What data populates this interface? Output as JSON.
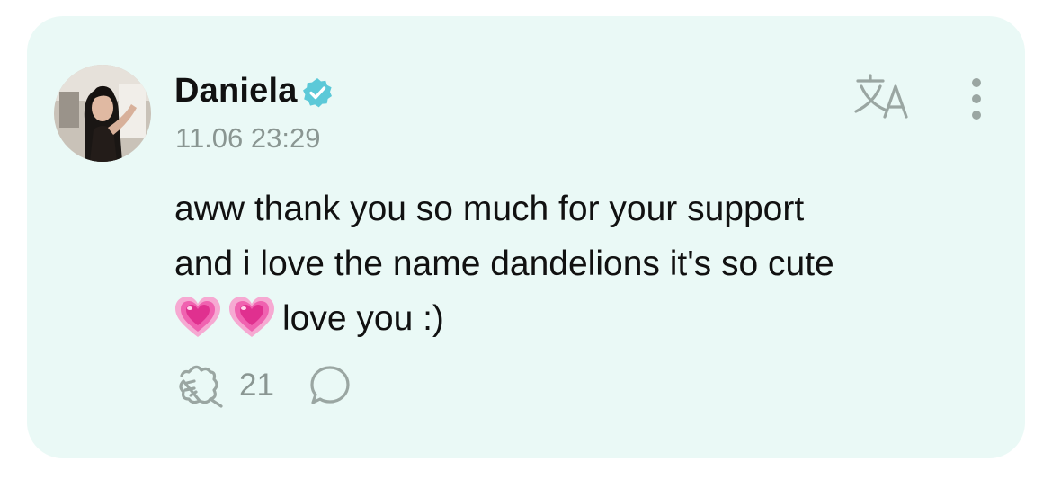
{
  "post": {
    "author": {
      "name": "Daniela",
      "verified": true,
      "avatar": "profile-photo"
    },
    "timestamp": "11.06 23:29",
    "text_lines": [
      "aww thank you so much for your support",
      "and i love the name dandelions it's so cute",
      "love you :)"
    ],
    "emoji": [
      "growing-heart-emoji",
      "growing-heart-emoji"
    ],
    "likes": "21",
    "icons": {
      "translate": "translate-icon",
      "more": "more-vertical-icon",
      "like": "like-paw-icon",
      "comment": "comment-bubble-icon",
      "verified": "verified-badge-icon"
    }
  },
  "colors": {
    "card_background": "#eaf9f6",
    "verified_badge": "#5cc9d8",
    "muted_text": "#8a9692",
    "icon_gray": "#9aa6a2",
    "heart_pink": "#f062b0"
  }
}
